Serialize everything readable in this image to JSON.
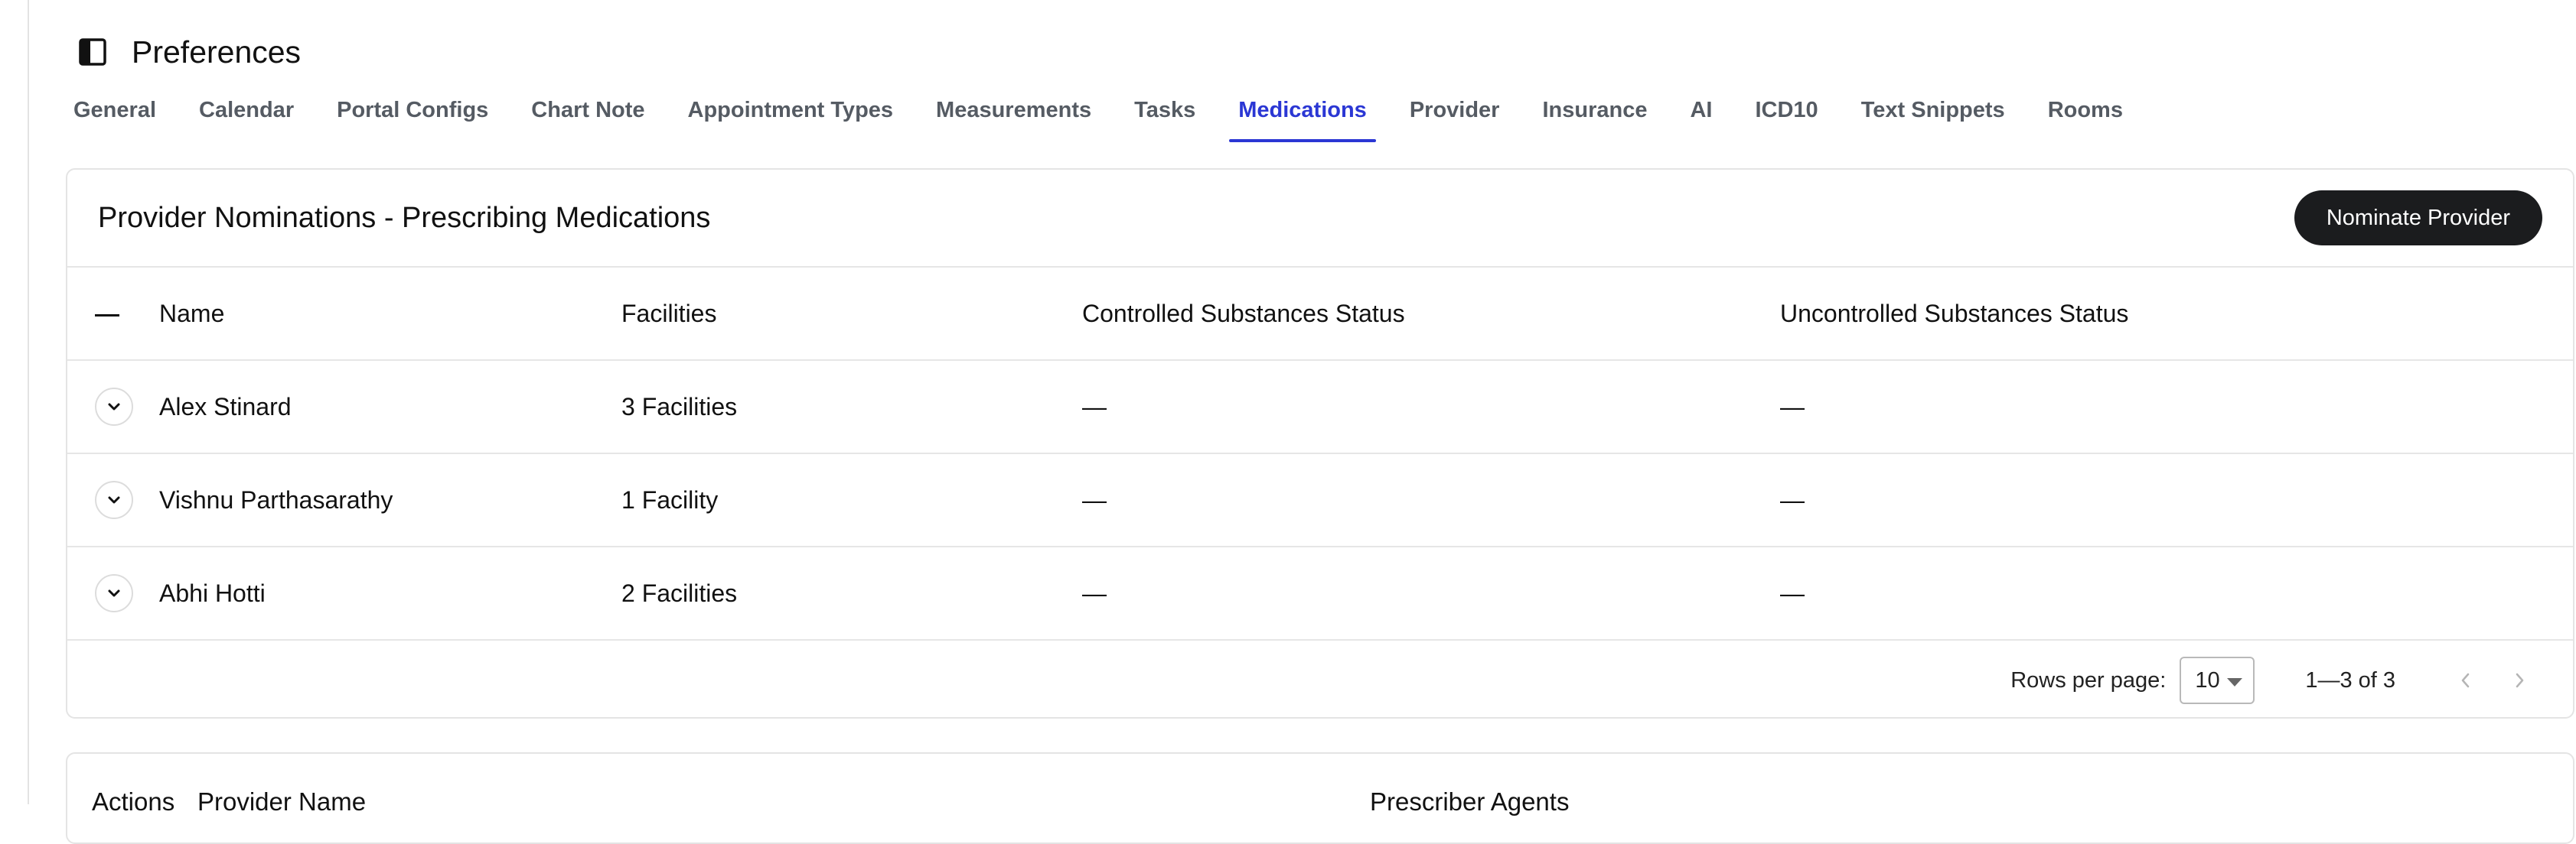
{
  "header": {
    "title": "Preferences",
    "toggle_icon": "sidebar-toggle-icon"
  },
  "tabs": [
    {
      "label": "General",
      "active": false
    },
    {
      "label": "Calendar",
      "active": false
    },
    {
      "label": "Portal Configs",
      "active": false
    },
    {
      "label": "Chart Note",
      "active": false
    },
    {
      "label": "Appointment Types",
      "active": false
    },
    {
      "label": "Measurements",
      "active": false
    },
    {
      "label": "Tasks",
      "active": false
    },
    {
      "label": "Medications",
      "active": true
    },
    {
      "label": "Provider",
      "active": false
    },
    {
      "label": "Insurance",
      "active": false
    },
    {
      "label": "AI",
      "active": false
    },
    {
      "label": "ICD10",
      "active": false
    },
    {
      "label": "Text Snippets",
      "active": false
    },
    {
      "label": "Rooms",
      "active": false
    }
  ],
  "nominations": {
    "title": "Provider Nominations - Prescribing Medications",
    "nominate_button": "Nominate Provider",
    "columns": {
      "select": "—",
      "name": "Name",
      "facilities": "Facilities",
      "controlled": "Controlled Substances Status",
      "uncontrolled": "Uncontrolled Substances Status"
    },
    "rows": [
      {
        "name": "Alex Stinard",
        "facilities": "3 Facilities",
        "controlled": "—",
        "uncontrolled": "—"
      },
      {
        "name": "Vishnu Parthasarathy",
        "facilities": "1 Facility",
        "controlled": "—",
        "uncontrolled": "—"
      },
      {
        "name": "Abhi Hotti",
        "facilities": "2 Facilities",
        "controlled": "—",
        "uncontrolled": "—"
      }
    ],
    "pagination": {
      "rows_per_page_label": "Rows per page:",
      "rows_per_page_value": "10",
      "range": "1—3 of 3"
    }
  },
  "agents": {
    "columns": {
      "actions": "Actions",
      "provider_name": "Provider Name",
      "prescriber_agents": "Prescriber Agents"
    }
  },
  "colors": {
    "accent": "#2b37d4",
    "primary_button": "#1b1c1e",
    "tab_text": "#555b63",
    "border": "#e4e4e4"
  }
}
